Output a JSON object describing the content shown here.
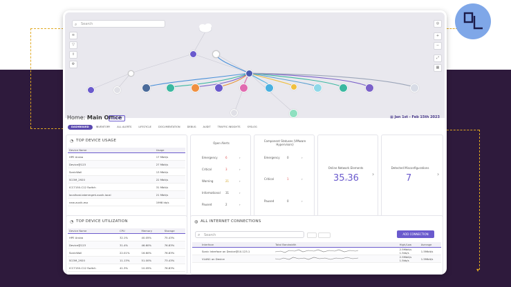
{
  "topology": {
    "search_placeholder": "Search",
    "left_tools": [
      "layers-icon",
      "filter-icon",
      "upload-icon",
      "settings-icon"
    ],
    "right_tools": [
      "target-icon",
      "plus-icon",
      "minus-icon",
      "expand-icon",
      "grid-icon"
    ]
  },
  "header": {
    "title_prefix": "Home: ",
    "title_bold": "Main Office",
    "export_label": "EXPORT",
    "date_range": "Jan 1st - Feb 15th 2023"
  },
  "tabs": [
    "DASHBOARD",
    "INVENTORY",
    "ALL ALERTS",
    "LIFECYCLE",
    "DOCUMENTATION",
    "DEBUG",
    "AUDIT",
    "TRAFFIC INSIGHTS",
    "SYSLOG"
  ],
  "top_device_usage": {
    "title": "TOP DEVICE USAGE",
    "columns": [
      "Device Name",
      "Usage"
    ],
    "rows": [
      [
        "HPE Aruba",
        "17 Mbit/s"
      ],
      [
        "Device@123",
        "27 Mbit/s"
      ],
      [
        "SonicWall",
        "13 Mbit/s"
      ],
      [
        "SCOM_2920",
        "22 Mbit/s"
      ],
      [
        "ICC7150-C12 Switch",
        "31 Mbit/s"
      ],
      [
        "localhost.labmmgmt.auvik.local",
        "21 Mbit/s"
      ],
      [
        "new-auvik-esx",
        "1998 kb/s"
      ]
    ]
  },
  "open_alerts": {
    "title": "Open Alerts",
    "rows": [
      {
        "label": "Emergency",
        "value": "6"
      },
      {
        "label": "Critical",
        "value": "3"
      },
      {
        "label": "Warning",
        "value": "21"
      },
      {
        "label": "Informational",
        "value": "31"
      },
      {
        "label": "Paused",
        "value": "2"
      }
    ]
  },
  "component_statuses": {
    "title": "Component Statuses (VMware Hypervisors)",
    "rows": [
      {
        "label": "Emergency",
        "value": "0"
      },
      {
        "label": "Critical",
        "value": "1"
      },
      {
        "label": "Paused",
        "value": "0"
      }
    ]
  },
  "online_elements": {
    "title": "Online Network Elements",
    "value_a": "35",
    "of": "of",
    "value_b": "36"
  },
  "misconfigs": {
    "title": "Detected Misconfigurations",
    "value": "7"
  },
  "top_device_util": {
    "title": "TOP DEVICE UTILIZATION",
    "columns": [
      "Device Name",
      "CPU",
      "Memory",
      "Storage"
    ],
    "rows": [
      [
        "HPE Aruba",
        "32.1%",
        "40.05%",
        "75.43%"
      ],
      [
        "Device@123",
        "31.4%",
        "46.60%",
        "76.83%"
      ],
      [
        "SonicWall",
        "22.01%",
        "16.60%",
        "76.83%"
      ],
      [
        "SCOM_2920",
        "11.13%",
        "51.00%",
        "73.43%"
      ],
      [
        "ICC7150-C12 Switch",
        "41.3%",
        "10.05%",
        "76.83%"
      ]
    ]
  },
  "internet_connections": {
    "title": "ALL INTERNET CONNECTIONS",
    "search_placeholder": "Search",
    "add_label": "ADD CONNECTION",
    "columns": [
      "Interface",
      "Total Bandwidth",
      "High/Low",
      "Average"
    ],
    "rows": [
      {
        "iface": "Sonic Interface on Device@10.123.1",
        "high": "2.5Mbit/s",
        "low": "1.5kb/s",
        "avg": "1.5Mbit/s"
      },
      {
        "iface": "VLAN1 on Device",
        "high": "2.5Mbit/s",
        "low": "1.5kb/s",
        "avg": "1.5Mbit/s"
      }
    ]
  },
  "colors": {
    "accent": "#6a5acd",
    "background_dark": "#2e1a3c",
    "dashed_line": "#e0a820",
    "logo_circle": "#7fa7e8"
  }
}
